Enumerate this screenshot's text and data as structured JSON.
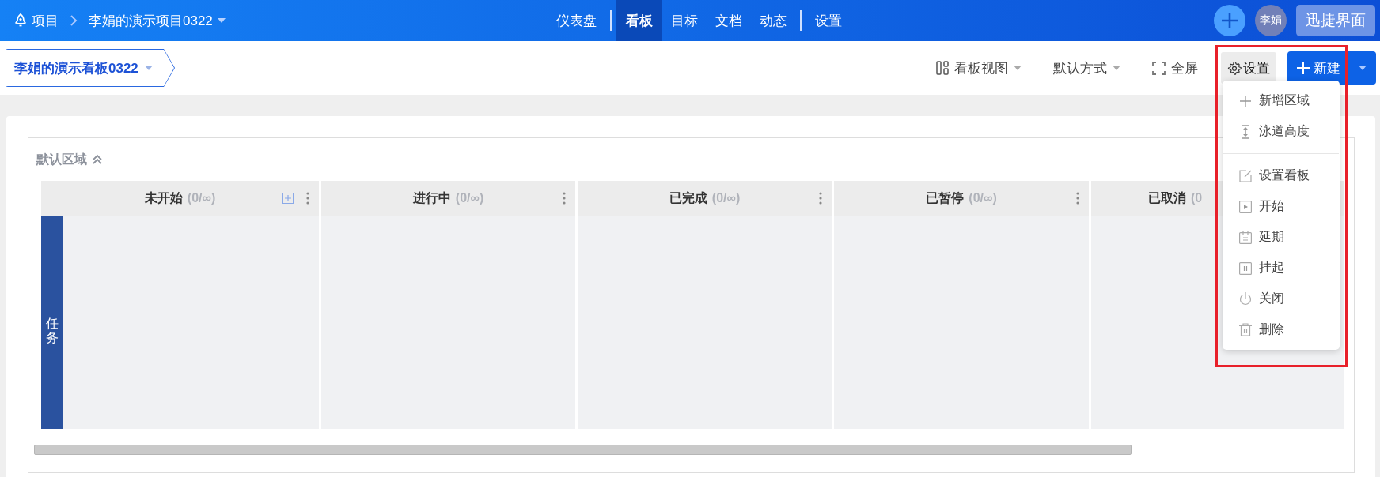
{
  "topbar": {
    "breadcrumb": [
      {
        "label": "项目",
        "kind": "root"
      },
      {
        "label": "李娟的演示项目0322",
        "kind": "project"
      }
    ],
    "nav": [
      {
        "label": "仪表盘",
        "selected": false,
        "divider_after": true
      },
      {
        "label": "看板",
        "selected": true,
        "divider_after": false
      },
      {
        "label": "目标",
        "selected": false,
        "divider_after": false
      },
      {
        "label": "文档",
        "selected": false,
        "divider_after": false
      },
      {
        "label": "动态",
        "selected": false,
        "divider_after": true
      },
      {
        "label": "设置",
        "selected": false,
        "divider_after": false
      }
    ],
    "avatar": "李娟",
    "quick_button": "迅捷界面"
  },
  "toolbar": {
    "board_title": "李娟的演示看板0322",
    "actions": [
      {
        "label": "看板视图",
        "kind": "view",
        "selected": false
      },
      {
        "label": "默认方式",
        "kind": "sort",
        "selected": false
      },
      {
        "label": "全屏",
        "kind": "fullscreen",
        "selected": false
      },
      {
        "label": "设置",
        "kind": "settings",
        "selected": true
      }
    ],
    "new_button": "新建"
  },
  "area": {
    "title": "默认区域",
    "expanded": true,
    "lane": "任务",
    "columns": [
      {
        "title": "未开始",
        "count": "(0/∞)",
        "add": true,
        "menu": true
      },
      {
        "title": "进行中",
        "count": "(0/∞)",
        "add": false,
        "menu": true
      },
      {
        "title": "已完成",
        "count": "(0/∞)",
        "add": false,
        "menu": true
      },
      {
        "title": "已暂停",
        "count": "(0/∞)",
        "add": false,
        "menu": true
      },
      {
        "title": "已取消",
        "count": "(0",
        "add": false,
        "menu": false
      }
    ]
  },
  "settings_menu": {
    "highlighted": true,
    "items": [
      {
        "label": "新增区域",
        "kind": "plus",
        "divider_after": false
      },
      {
        "label": "泳道高度",
        "kind": "height",
        "divider_after": true
      },
      {
        "label": "设置看板",
        "kind": "edit",
        "divider_after": false
      },
      {
        "label": "开始",
        "kind": "play",
        "divider_after": false
      },
      {
        "label": "延期",
        "kind": "calendar",
        "divider_after": false
      },
      {
        "label": "挂起",
        "kind": "pause",
        "divider_after": false
      },
      {
        "label": "关闭",
        "kind": "power",
        "divider_after": false
      },
      {
        "label": "删除",
        "kind": "trash",
        "divider_after": false
      }
    ]
  }
}
